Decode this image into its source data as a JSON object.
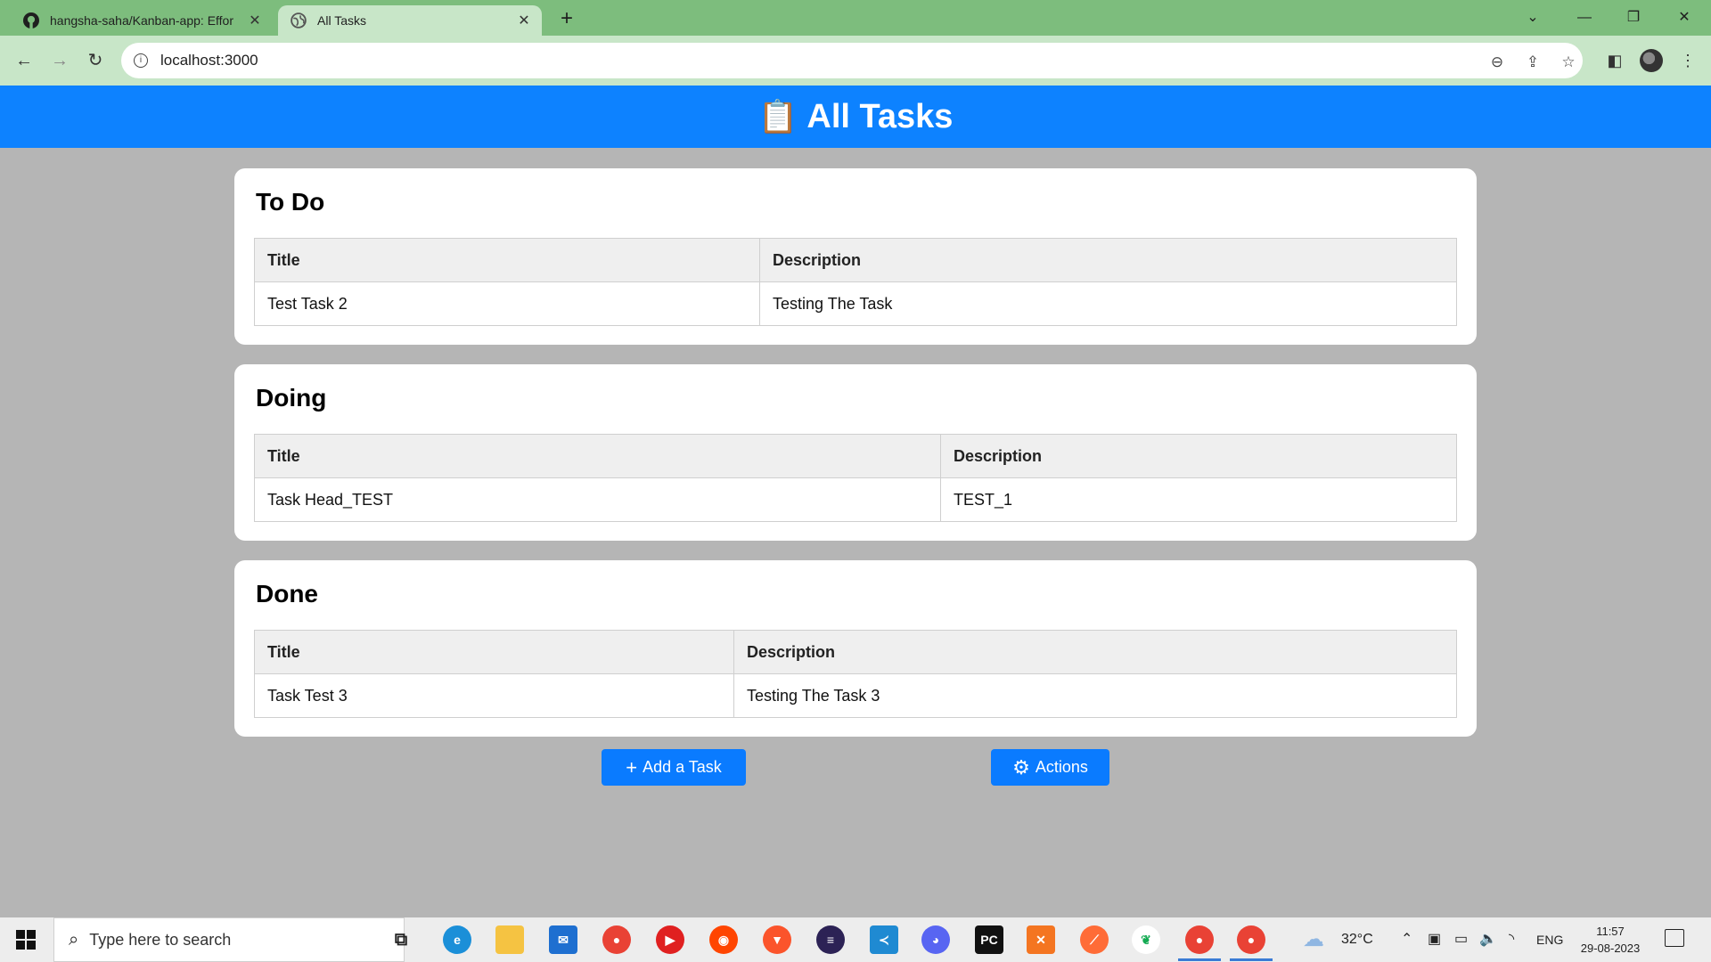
{
  "browser": {
    "tabs": [
      {
        "title": "hangsha-saha/Kanban-app: Effor",
        "icon": "github-icon",
        "active": false
      },
      {
        "title": "All Tasks",
        "icon": "globe-icon",
        "active": true
      }
    ],
    "new_tab_label": "+",
    "url": "localhost:3000"
  },
  "page": {
    "header_icon": "📋",
    "title": "All Tasks",
    "sections": [
      {
        "heading": "To Do",
        "columns": [
          "Title",
          "Description"
        ],
        "rows": [
          [
            "Test Task 2",
            "Testing The Task"
          ]
        ]
      },
      {
        "heading": "Doing",
        "columns": [
          "Title",
          "Description"
        ],
        "rows": [
          [
            "Task Head_TEST",
            "TEST_1"
          ]
        ]
      },
      {
        "heading": "Done",
        "columns": [
          "Title",
          "Description"
        ],
        "rows": [
          [
            "Task Test 3",
            "Testing The Task 3"
          ]
        ]
      }
    ],
    "buttons": {
      "add_task": {
        "icon": "plus-icon",
        "label": "Add a Task"
      },
      "actions": {
        "icon": "gear-icon",
        "label": "Actions"
      }
    },
    "colors": {
      "header": "#0d82ff",
      "button": "#0a7bff",
      "background": "#b5b5b5"
    }
  },
  "taskbar": {
    "search_placeholder": "Type here to search",
    "weather": "32°C",
    "language": "ENG",
    "time": "11:57",
    "date": "29-08-2023"
  }
}
